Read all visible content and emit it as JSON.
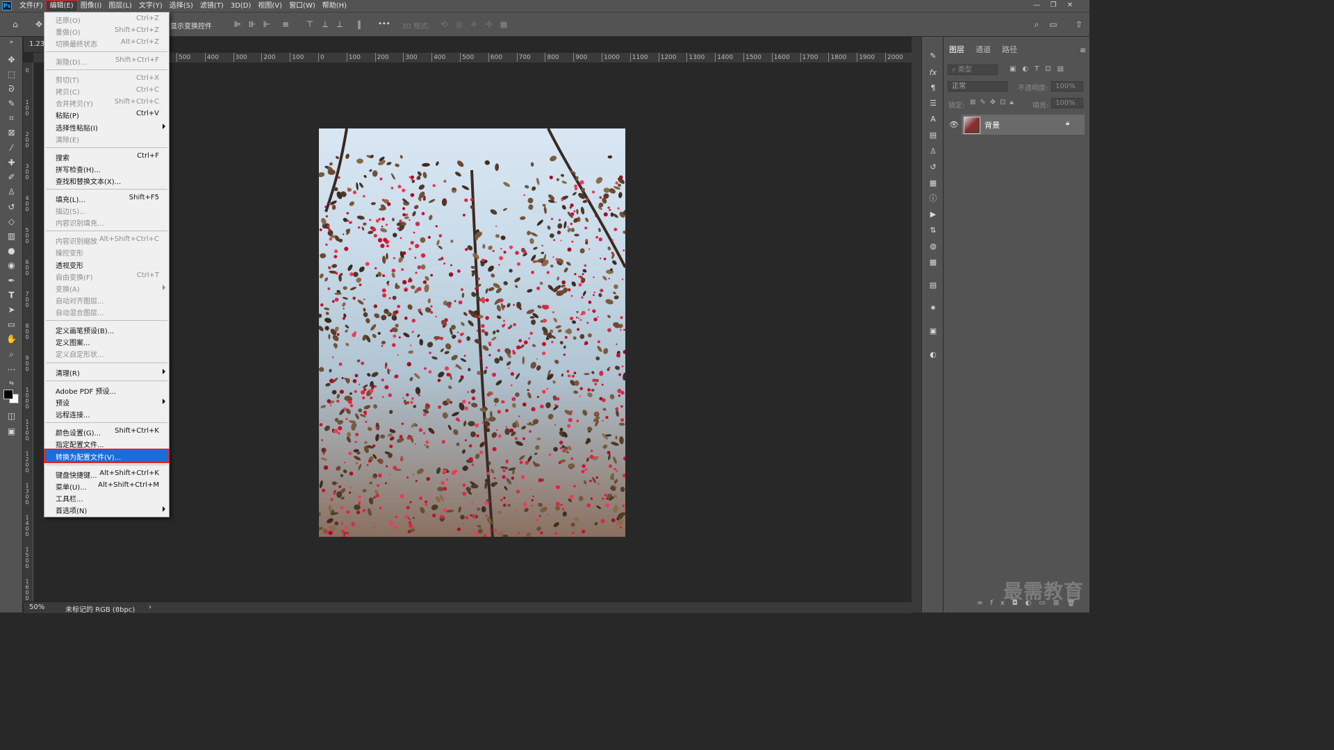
{
  "menubar": {
    "logo": "Ps",
    "items": [
      "文件(F)",
      "编辑(E)",
      "图像(I)",
      "图层(L)",
      "文字(Y)",
      "选择(S)",
      "滤镜(T)",
      "3D(D)",
      "视图(V)",
      "窗口(W)",
      "帮助(H)"
    ],
    "active": "编辑(E)",
    "window_controls": [
      "—",
      "❐",
      "✕"
    ]
  },
  "options_bar": {
    "transform_controls": "显示变换控件",
    "mode_3d": "3D 模式:",
    "more": "•••"
  },
  "document": {
    "tab_label": "1.23.",
    "zoom": "50%",
    "color_profile": "未标记的 RGB (8bpc)",
    "status_arrow": "›"
  },
  "ruler": {
    "h_labels": [
      "500",
      "400",
      "300",
      "200",
      "100",
      "0",
      "100",
      "200",
      "300",
      "400",
      "500",
      "600",
      "700",
      "800",
      "900",
      "1000",
      "1100",
      "1200",
      "1300",
      "1400",
      "1500",
      "1600",
      "1700",
      "1800",
      "1900",
      "2000"
    ],
    "v_labels": [
      "0",
      "100",
      "200",
      "300",
      "400",
      "500",
      "600",
      "700",
      "800",
      "900",
      "1000",
      "1100",
      "1200",
      "1300",
      "1400",
      "1500",
      "1600"
    ]
  },
  "edit_menu": {
    "items": [
      {
        "label": "还原(O)",
        "shortcut": "Ctrl+Z",
        "disabled": true
      },
      {
        "label": "重做(O)",
        "shortcut": "Shift+Ctrl+Z",
        "disabled": true
      },
      {
        "label": "切换最终状态",
        "shortcut": "Alt+Ctrl+Z",
        "disabled": true
      },
      {
        "label": "渐隐(D)...",
        "shortcut": "Shift+Ctrl+F",
        "disabled": true
      },
      {
        "label": "剪切(T)",
        "shortcut": "Ctrl+X",
        "disabled": true
      },
      {
        "label": "拷贝(C)",
        "shortcut": "Ctrl+C",
        "disabled": true
      },
      {
        "label": "合并拷贝(Y)",
        "shortcut": "Shift+Ctrl+C",
        "disabled": true
      },
      {
        "label": "粘贴(P)",
        "shortcut": "Ctrl+V",
        "disabled": false
      },
      {
        "label": "选择性粘贴(I)",
        "shortcut": "",
        "disabled": false,
        "submenu": true
      },
      {
        "label": "清除(E)",
        "shortcut": "",
        "disabled": true
      },
      {
        "label": "搜索",
        "shortcut": "Ctrl+F",
        "disabled": false
      },
      {
        "label": "拼写检查(H)...",
        "shortcut": "",
        "disabled": false
      },
      {
        "label": "查找和替换文本(X)...",
        "shortcut": "",
        "disabled": false
      },
      {
        "label": "填充(L)...",
        "shortcut": "Shift+F5",
        "disabled": false
      },
      {
        "label": "描边(S)...",
        "shortcut": "",
        "disabled": true
      },
      {
        "label": "内容识别填充...",
        "shortcut": "",
        "disabled": true
      },
      {
        "label": "内容识别缩放",
        "shortcut": "Alt+Shift+Ctrl+C",
        "disabled": true
      },
      {
        "label": "操控变形",
        "shortcut": "",
        "disabled": true
      },
      {
        "label": "透视变形",
        "shortcut": "",
        "disabled": false
      },
      {
        "label": "自由变换(F)",
        "shortcut": "Ctrl+T",
        "disabled": true
      },
      {
        "label": "变换(A)",
        "shortcut": "",
        "disabled": true,
        "submenu": true
      },
      {
        "label": "自动对齐图层...",
        "shortcut": "",
        "disabled": true
      },
      {
        "label": "自动混合图层...",
        "shortcut": "",
        "disabled": true
      },
      {
        "label": "定义画笔预设(B)...",
        "shortcut": "",
        "disabled": false
      },
      {
        "label": "定义图案...",
        "shortcut": "",
        "disabled": false
      },
      {
        "label": "定义自定形状...",
        "shortcut": "",
        "disabled": true
      },
      {
        "label": "清理(R)",
        "shortcut": "",
        "disabled": false,
        "submenu": true
      },
      {
        "label": "Adobe PDF 预设...",
        "shortcut": "",
        "disabled": false
      },
      {
        "label": "预设",
        "shortcut": "",
        "disabled": false,
        "submenu": true
      },
      {
        "label": "远程连接...",
        "shortcut": "",
        "disabled": false
      },
      {
        "label": "颜色设置(G)...",
        "shortcut": "Shift+Ctrl+K",
        "disabled": false
      },
      {
        "label": "指定配置文件...",
        "shortcut": "",
        "disabled": false
      },
      {
        "label": "转换为配置文件(V)...",
        "shortcut": "",
        "disabled": false,
        "highlighted": true
      },
      {
        "label": "键盘快捷键...",
        "shortcut": "Alt+Shift+Ctrl+K",
        "disabled": false
      },
      {
        "label": "菜单(U)...",
        "shortcut": "Alt+Shift+Ctrl+M",
        "disabled": false
      },
      {
        "label": "工具栏...",
        "shortcut": "",
        "disabled": false
      },
      {
        "label": "首选项(N)",
        "shortcut": "",
        "disabled": false,
        "submenu": true
      }
    ]
  },
  "layers_panel": {
    "tabs": [
      "图层",
      "通道",
      "路径"
    ],
    "active_tab": "图层",
    "filter_placeholder": "类型",
    "blend_mode": "正常",
    "opacity_label": "不透明度:",
    "opacity_value": "100%",
    "lock_label": "锁定:",
    "fill_label": "填充:",
    "fill_value": "100%",
    "layer_name": "背景"
  },
  "watermark": "最需教育",
  "colors": {
    "ui_dark": "#535353",
    "canvas_bg": "#282828",
    "menu_bg": "#f0f0f0",
    "highlight": "#1a6ed8",
    "annotation_red": "#e0262b"
  }
}
